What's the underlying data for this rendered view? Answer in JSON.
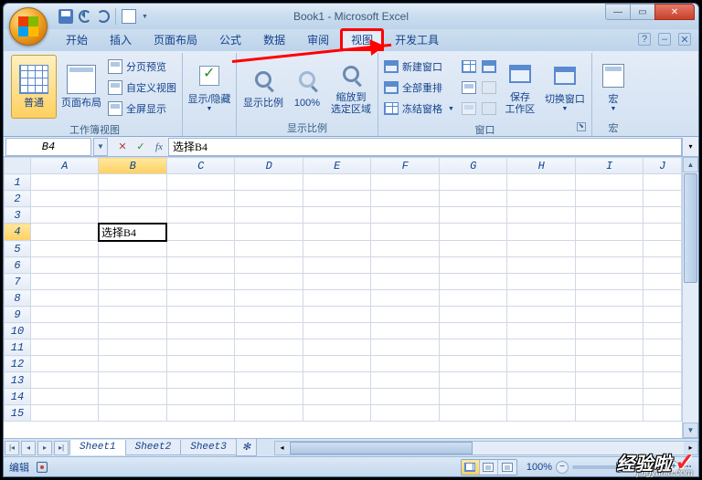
{
  "title": "Book1 - Microsoft Excel",
  "tabs": {
    "t0": "开始",
    "t1": "插入",
    "t2": "页面布局",
    "t3": "公式",
    "t4": "数据",
    "t5": "审阅",
    "t6": "视图",
    "t7": "开发工具"
  },
  "ribbon": {
    "g1": {
      "label": "工作簿视图",
      "normal": "普通",
      "pagelayout": "页面布局",
      "pagebreak": "分页预览",
      "custom": "自定义视图",
      "fullscreen": "全屏显示"
    },
    "g2": {
      "showhide": "显示/隐藏"
    },
    "g3": {
      "label": "显示比例",
      "zoom": "显示比例",
      "hundred": "100%",
      "zoomsel": "缩放到\n选定区域"
    },
    "g4": {
      "label": "窗口",
      "newwin": "新建窗口",
      "arrange": "全部重排",
      "freeze": "冻结窗格",
      "save": "保存\n工作区",
      "switch": "切换窗口"
    },
    "g5": {
      "label": "宏",
      "macro": "宏"
    }
  },
  "namebox": "B4",
  "formula_value": "选择B4",
  "cell_b4": "选择B4",
  "cols": {
    "A": "A",
    "B": "B",
    "C": "C",
    "D": "D",
    "E": "E",
    "F": "F",
    "G": "G",
    "H": "H",
    "I": "I",
    "J": "J"
  },
  "rows": {
    "1": "1",
    "2": "2",
    "3": "3",
    "4": "4",
    "5": "5",
    "6": "6",
    "7": "7",
    "8": "8",
    "9": "9",
    "10": "10",
    "11": "11",
    "12": "12",
    "13": "13",
    "14": "14",
    "15": "15"
  },
  "sheets": {
    "s1": "Sheet1",
    "s2": "Sheet2",
    "s3": "Sheet3"
  },
  "status": "编辑",
  "zoom_pct": "100%",
  "watermark": "经验啦",
  "watermark_url": "jingyanla.com"
}
